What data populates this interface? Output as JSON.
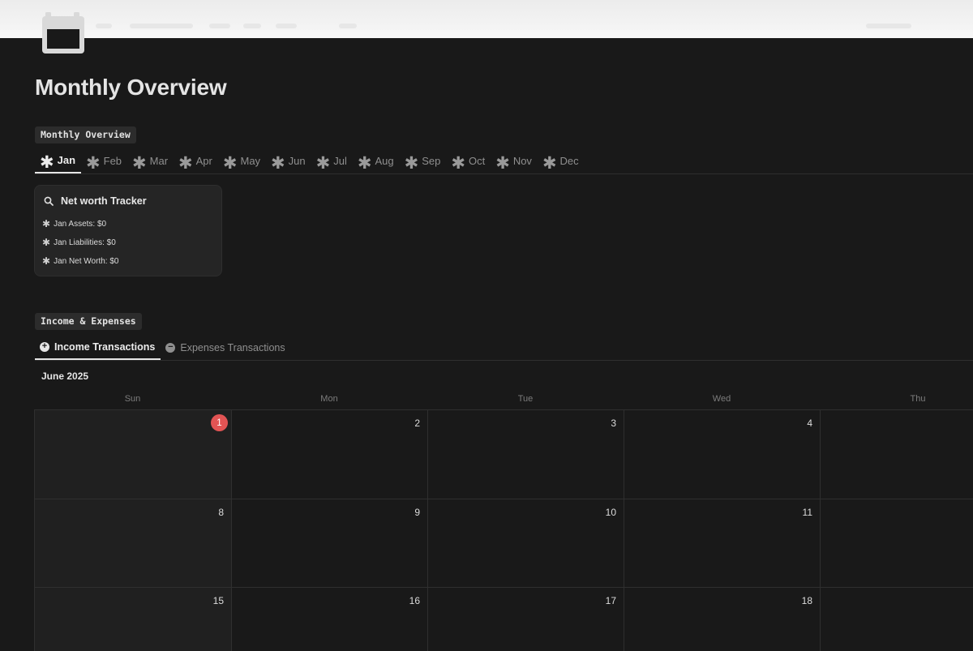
{
  "page": {
    "title": "Monthly Overview",
    "icon": "calendar-icon"
  },
  "monthly_section": {
    "label": "Monthly Overview",
    "tabs": [
      {
        "label": "Jan",
        "active": true
      },
      {
        "label": "Feb"
      },
      {
        "label": "Mar"
      },
      {
        "label": "Apr"
      },
      {
        "label": "May"
      },
      {
        "label": "Jun"
      },
      {
        "label": "Jul"
      },
      {
        "label": "Aug"
      },
      {
        "label": "Sep"
      },
      {
        "label": "Oct"
      },
      {
        "label": "Nov"
      },
      {
        "label": "Dec"
      }
    ],
    "tab_icon": "✱",
    "card": {
      "title": "Net worth Tracker",
      "icon": "search-icon",
      "properties": [
        {
          "text": "Jan Assets: $0"
        },
        {
          "text": "Jan Liabilities: $0"
        },
        {
          "text": "Jan Net Worth: $0"
        }
      ]
    }
  },
  "income_section": {
    "label": "Income & Expenses",
    "tabs": [
      {
        "label": "Income Transactions",
        "icon": "plus-circle-icon",
        "active": true
      },
      {
        "label": "Expenses Transactions",
        "icon": "minus-circle-icon"
      }
    ]
  },
  "calendar": {
    "month": "June 2025",
    "weekdays": [
      "Sun",
      "Mon",
      "Tue",
      "Wed",
      "Thu"
    ],
    "weeks": [
      [
        "1",
        "2",
        "3",
        "4",
        ""
      ],
      [
        "8",
        "9",
        "10",
        "11",
        ""
      ],
      [
        "15",
        "16",
        "17",
        "18",
        ""
      ]
    ],
    "today": "1",
    "today_color": "#e25454"
  }
}
